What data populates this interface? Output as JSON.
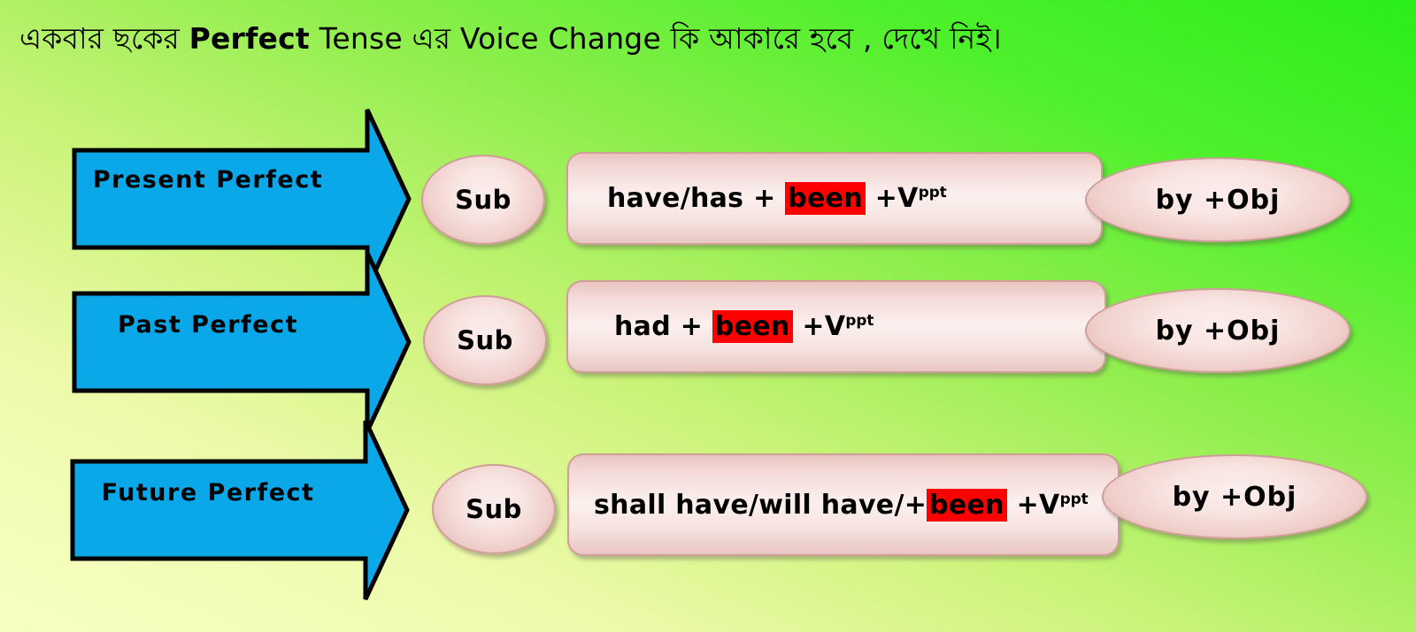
{
  "title": {
    "full": "একবার ছকের Perfect Tense এর  Voice Change কি আকারে হবে ,  দেখে নিই।",
    "part_bn_1": "একবার ছকের ",
    "part_en_bold": "Perfect",
    "part_en_1": " Tense ",
    "part_bn_2": " এর   ",
    "part_en_2": "Voice Change ",
    "part_bn_3": " কি আকারে হবে ,  দেখে নিই।"
  },
  "colors": {
    "arrow_fill": "#0aa8e8",
    "arrow_stroke": "#000000",
    "highlight_red": "#ff0000",
    "pink_fill": "#f8e5e2",
    "pink_border": "#cf9e99",
    "bg_pale": "#f7ffc4",
    "bg_green": "#2bee1c"
  },
  "rows": [
    {
      "tense": "Present Perfect",
      "subject": "Sub",
      "formula": {
        "prefix": "have/has  + ",
        "highlight": "been",
        "suffix": " +V",
        "superscript": "ppt"
      },
      "object": "by +Obj"
    },
    {
      "tense": "Past Perfect",
      "subject": "Sub",
      "formula": {
        "prefix": "had   + ",
        "highlight": "been",
        "suffix": " +V",
        "superscript": "ppt"
      },
      "object": "by +Obj"
    },
    {
      "tense": "Future Perfect",
      "subject": "Sub",
      "formula": {
        "prefix": "shall have/will have/+",
        "highlight": "been",
        "suffix": " +V",
        "superscript": "ppt"
      },
      "object": "by +Obj"
    }
  ]
}
